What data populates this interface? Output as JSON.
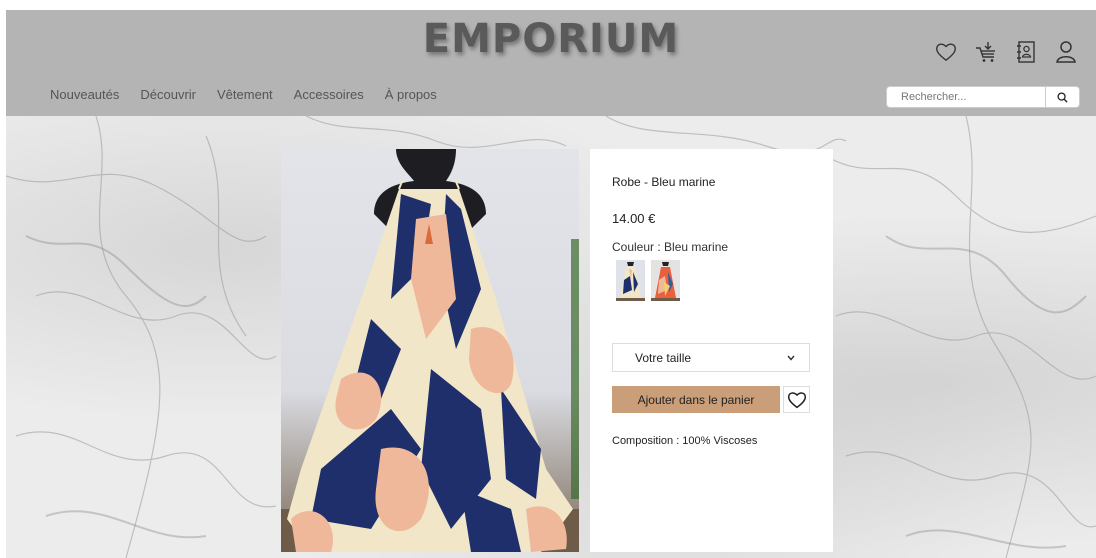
{
  "header": {
    "logo": "EMPORIUM",
    "icons": [
      "heart-icon",
      "cart-icon",
      "contact-book-icon",
      "user-icon"
    ]
  },
  "nav": {
    "items": [
      {
        "label": "Nouveautés"
      },
      {
        "label": "Découvrir"
      },
      {
        "label": "Vêtement"
      },
      {
        "label": "Accessoires"
      },
      {
        "label": "À propos"
      }
    ]
  },
  "search": {
    "placeholder": "Rechercher...",
    "value": ""
  },
  "product": {
    "name": "Robe - Bleu marine",
    "price": "14.00 €",
    "color_label": "Couleur : Bleu marine",
    "size_select": "Votre taille",
    "add_to_cart": "Ajouter dans le panier",
    "composition": "Composition : 100% Viscoses"
  },
  "colors": {
    "header_bg": "#b4b4b4",
    "accent": "#c99e78",
    "navy": "#1f2f6b",
    "peach": "#f0b89a",
    "cream": "#f1e6c8"
  }
}
